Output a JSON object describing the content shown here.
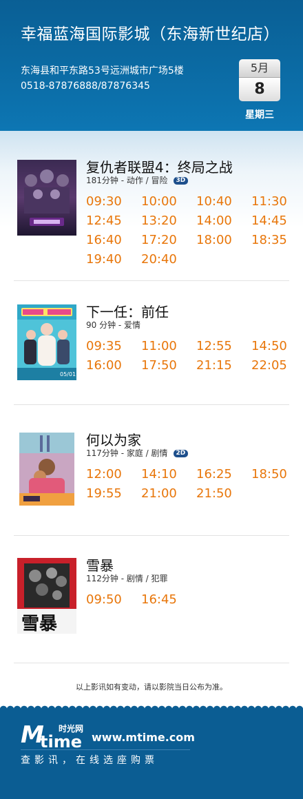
{
  "header": {
    "cinema_name": "幸福蓝海国际影城（东海新世纪店）",
    "address": "东海县和平东路53号远洲城市广场5楼",
    "phone": "0518-87876888/87876345",
    "date": {
      "month": "5月",
      "day": "8",
      "weekday": "星期三"
    },
    "colors": {
      "header_bg": "#0b6aa3",
      "time_text": "#e8760a",
      "footer_bg": "#0b5d93"
    }
  },
  "movies": [
    {
      "title": "复仇者联盟4：终局之战",
      "meta": "181分钟 - 动作 / 冒险",
      "format": "3D",
      "poster_icon": "poster-avengers-endgame",
      "times": [
        "09:30",
        "10:00",
        "10:40",
        "11:30",
        "12:45",
        "13:20",
        "14:00",
        "14:45",
        "16:40",
        "17:20",
        "18:00",
        "18:35",
        "19:40",
        "20:40"
      ]
    },
    {
      "title": "下一任：前任",
      "meta": "90 分钟 - 爱情",
      "format": "",
      "poster_icon": "poster-xia-yi-ren-qian-ren",
      "poster_date": "05/01",
      "times": [
        "09:35",
        "11:00",
        "12:55",
        "14:50",
        "16:00",
        "17:50",
        "21:15",
        "22:05"
      ]
    },
    {
      "title": "何以为家",
      "meta": "117分钟 - 家庭 / 剧情",
      "format": "2D",
      "poster_icon": "poster-capernaum",
      "times": [
        "12:00",
        "14:10",
        "16:25",
        "18:50",
        "19:55",
        "21:00",
        "21:50"
      ]
    },
    {
      "title": "雪暴",
      "meta": "112分钟 - 剧情 / 犯罪",
      "format": "",
      "poster_icon": "poster-xue-bao",
      "poster_text": "雪暴",
      "times": [
        "09:50",
        "16:45"
      ]
    }
  ],
  "notice": "以上影讯如有变动，请以影院当日公布为准。",
  "footer": {
    "logo_m": "M",
    "logo_time": "time",
    "logo_cn": "时光网",
    "url": "www.mtime.com",
    "slogan": "查影讯，在线选座购票"
  }
}
